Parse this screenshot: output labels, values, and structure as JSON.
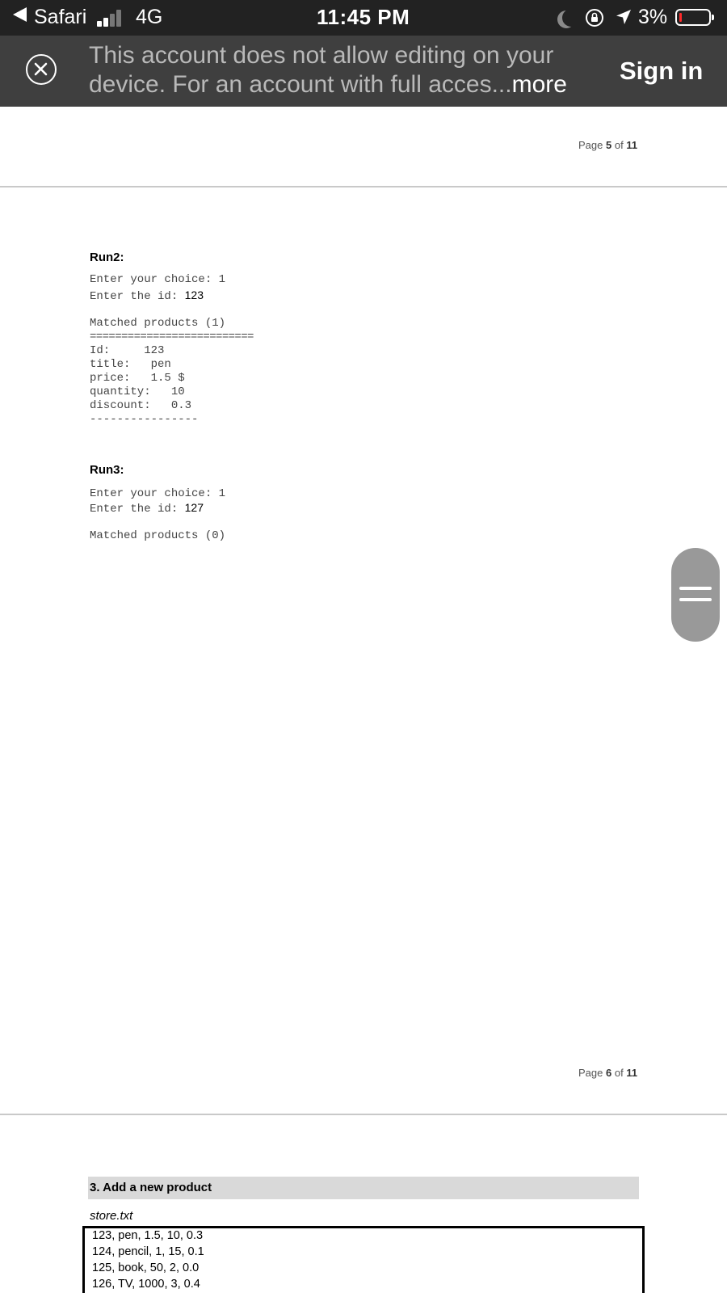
{
  "status_bar": {
    "back_app": "Safari",
    "network": "4G",
    "time": "11:45 PM",
    "battery_percent": "3%",
    "battery_color": "#ff2a2a",
    "icons": [
      "back-arrow-icon",
      "signal-icon",
      "moon-icon",
      "rotation-lock-icon",
      "location-arrow-icon",
      "battery-icon"
    ]
  },
  "banner": {
    "message": "This account does not allow editing on your device. For an account with full acces...",
    "more_label": "more",
    "signin_label": "Sign in",
    "icons": [
      "close-icon"
    ]
  },
  "pages": {
    "page5": {
      "prefix": "Page",
      "num": "5",
      "of": "of",
      "total": "11"
    },
    "page6": {
      "prefix": "Page",
      "num": "6",
      "of": "of",
      "total": "11"
    }
  },
  "run2": {
    "heading": "Run2:",
    "choice_prompt": "Enter your choice: 1",
    "id_prompt": "Enter the id: ",
    "id_value": "123",
    "matched": "Matched products (1)",
    "separator_top": "==========================",
    "lines": [
      "Id:     123",
      "title:   pen",
      "price:   1.5 $",
      "quantity:   10",
      "discount:   0.3"
    ],
    "separator_bottom": "----------------"
  },
  "run3": {
    "heading": "Run3:",
    "choice_prompt": "Enter your choice: 1",
    "id_prompt": "Enter the id: ",
    "id_value": "127",
    "matched": "Matched products (0)"
  },
  "section": {
    "title": "3. Add a new product",
    "file_label": "store.txt",
    "file_lines": [
      "123, pen, 1.5, 10, 0.3",
      "124, pencil, 1, 15, 0.1",
      "125, book, 50, 2, 0.0",
      "126, TV, 1000, 3, 0.4"
    ]
  }
}
